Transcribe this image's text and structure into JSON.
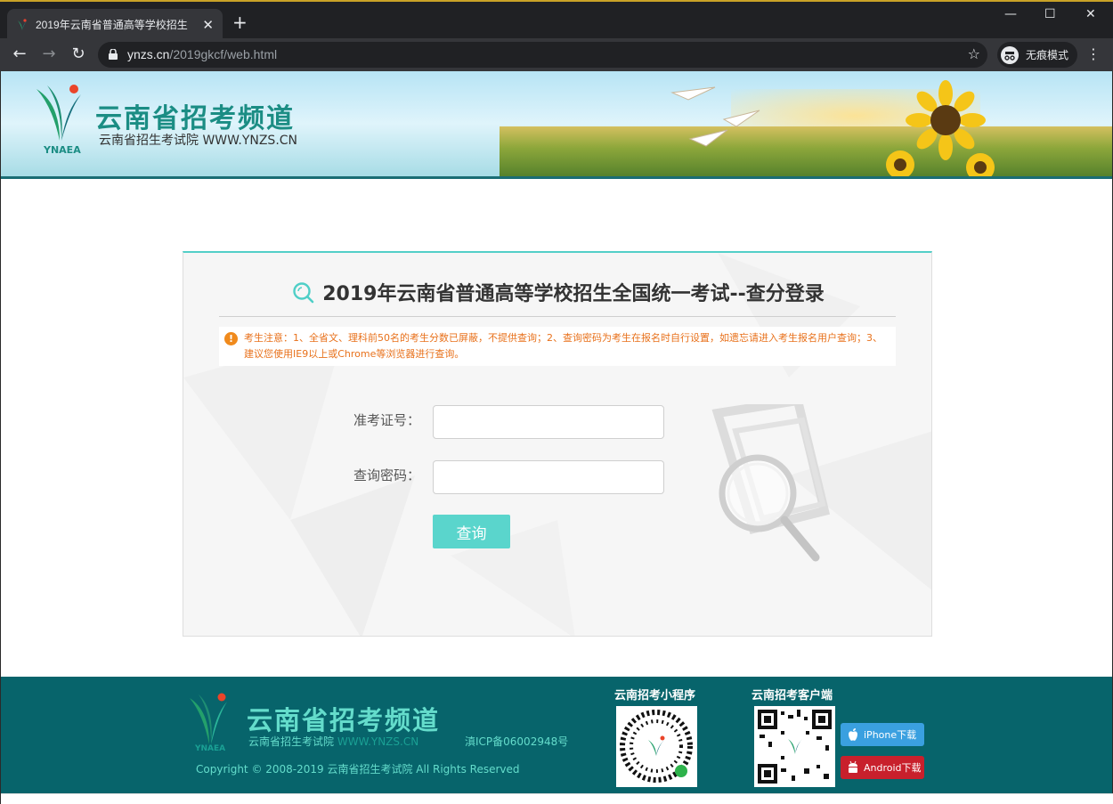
{
  "browser": {
    "tab_title": "2019年云南省普通高等学校招生",
    "url_host": "ynzs.cn",
    "url_path": "/2019gkcf/web.html",
    "incognito_label": "无痕模式",
    "minimize": "—",
    "maximize": "☐",
    "close": "✕"
  },
  "header": {
    "brand_title": "云南省招考频道",
    "brand_sub": "云南省招生考试院 WWW.YNZS.CN",
    "brand_abbr": "YNAEA"
  },
  "login": {
    "title": "2019年云南省普通高等学校招生全国统一考试--查分登录",
    "notice": "考生注意：1、全省文、理科前50名的考生分数已屏蔽，不提供查询；2、查询密码为考生在报名时自行设置，如遗忘请进入考生报名用户查询；3、建议您使用IE9以上或Chrome等浏览器进行查询。",
    "exam_no_label": "准考证号：",
    "exam_no_value": "",
    "password_label": "查询密码：",
    "password_value": "",
    "submit_label": "查询"
  },
  "footer": {
    "brand_title": "云南省招考频道",
    "brand_sub": "云南省招生考试院",
    "site": "WWW.YNZS.CN",
    "icp": "滇ICP备06002948号",
    "copyright": "Copyright © 2008-2019  云南省招生考试院 All Rights Reserved",
    "brand_abbr": "YNAEA",
    "miniprogram_label": "云南招考小程序",
    "client_label": "云南招考客户端",
    "iphone_label": "iPhone下载",
    "android_label": "Android下载"
  },
  "colors": {
    "accent": "#53cfc8",
    "footer_bg": "#07646b",
    "notice": "#e8711b"
  }
}
